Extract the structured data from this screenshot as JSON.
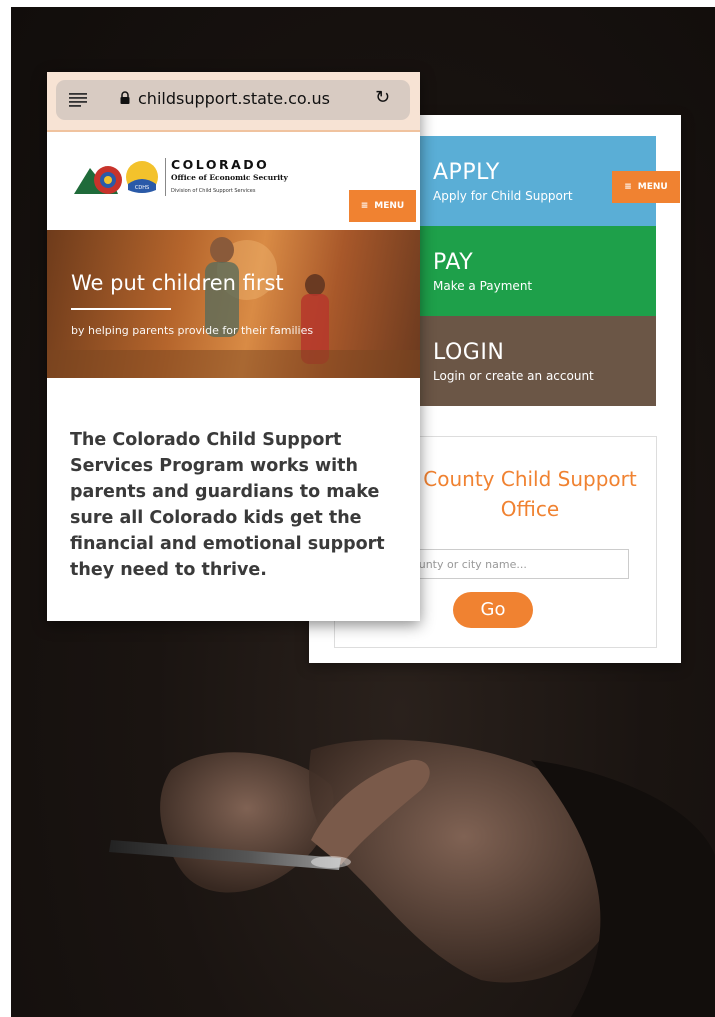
{
  "browser": {
    "url": "childsupport.state.co.us"
  },
  "header": {
    "title": "COLORADO",
    "subtitle": "Office of Economic Security",
    "division": "Division of Child Support Services",
    "menu_label": "MENU"
  },
  "hero": {
    "headline": "We put children first",
    "tagline": "by helping parents provide for their families"
  },
  "intro_text": "The Colorado Child Support Services Program works with parents and guardians to make sure all Colorado kids get the financial and emotional support they need to thrive.",
  "actions": [
    {
      "title": "APPLY",
      "subtitle": "Apply for Child Support",
      "color": "#5aaed6"
    },
    {
      "title": "PAY",
      "subtitle": "Make a Payment",
      "color": "#1ea04a"
    },
    {
      "title": "LOGIN",
      "subtitle": "Login or create an account",
      "color": "#6b5646"
    }
  ],
  "county_search": {
    "title_line1": "County Child Support",
    "title_line2": "Office",
    "placeholder": "ounty or city name...",
    "button": "Go"
  },
  "colors": {
    "accent_orange": "#f08231",
    "apply_blue": "#5aaed6",
    "pay_green": "#1ea04a",
    "login_brown": "#6b5646"
  }
}
